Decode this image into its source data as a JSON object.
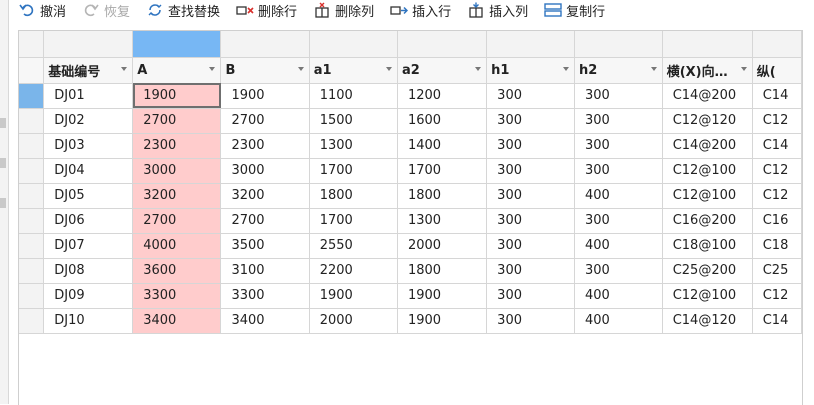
{
  "toolbar": {
    "undo": "撤消",
    "redo": "恢复",
    "find_replace": "查找替换",
    "delete_row": "删除行",
    "delete_col": "删除列",
    "insert_row": "插入行",
    "insert_col": "插入列",
    "copy_row": "复制行"
  },
  "headers": [
    "基础编号",
    "A",
    "B",
    "a1",
    "a2",
    "h1",
    "h2",
    "横(X)向…",
    "纵("
  ],
  "rows": [
    [
      "DJ01",
      "1900",
      "1900",
      "1100",
      "1200",
      "300",
      "300",
      "C14@200",
      "C14"
    ],
    [
      "DJ02",
      "2700",
      "2700",
      "1500",
      "1600",
      "300",
      "300",
      "C12@120",
      "C12"
    ],
    [
      "DJ03",
      "2300",
      "2300",
      "1300",
      "1400",
      "300",
      "300",
      "C14@200",
      "C14"
    ],
    [
      "DJ04",
      "3000",
      "3000",
      "1700",
      "1700",
      "300",
      "300",
      "C12@100",
      "C12"
    ],
    [
      "DJ05",
      "3200",
      "3200",
      "1800",
      "1800",
      "300",
      "400",
      "C12@100",
      "C12"
    ],
    [
      "DJ06",
      "2700",
      "2700",
      "1700",
      "1300",
      "300",
      "300",
      "C16@200",
      "C16"
    ],
    [
      "DJ07",
      "4000",
      "3500",
      "2550",
      "2000",
      "300",
      "400",
      "C18@100",
      "C18"
    ],
    [
      "DJ08",
      "3600",
      "3100",
      "2200",
      "1800",
      "300",
      "300",
      "C25@200",
      "C25"
    ],
    [
      "DJ09",
      "3300",
      "3300",
      "1900",
      "1900",
      "300",
      "400",
      "C12@100",
      "C12"
    ],
    [
      "DJ10",
      "3400",
      "3400",
      "2000",
      "1900",
      "300",
      "400",
      "C14@120",
      "C14"
    ]
  ],
  "colors": {
    "selected_column_fill": "#ffcccc",
    "column_header_selected": "#77b7f4",
    "row_header_selected": "#7ab5ea"
  }
}
